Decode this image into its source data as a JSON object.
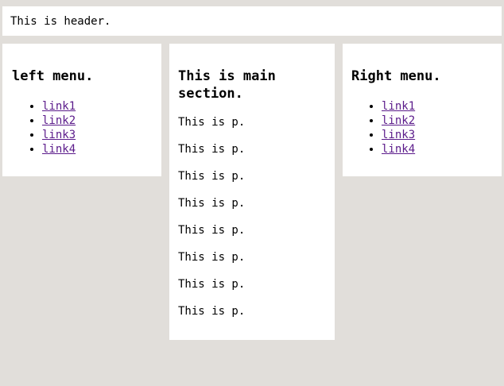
{
  "header": {
    "text": "This is header."
  },
  "left_menu": {
    "title": "left menu.",
    "links": [
      "link1",
      "link2",
      "link3",
      "link4"
    ]
  },
  "main": {
    "title": "This is main section.",
    "paragraphs": [
      "This is p.",
      "This is p.",
      "This is p.",
      "This is p.",
      "This is p.",
      "This is p.",
      "This is p.",
      "This is p."
    ]
  },
  "right_menu": {
    "title": "Right menu.",
    "links": [
      "link1",
      "link2",
      "link3",
      "link4"
    ]
  }
}
